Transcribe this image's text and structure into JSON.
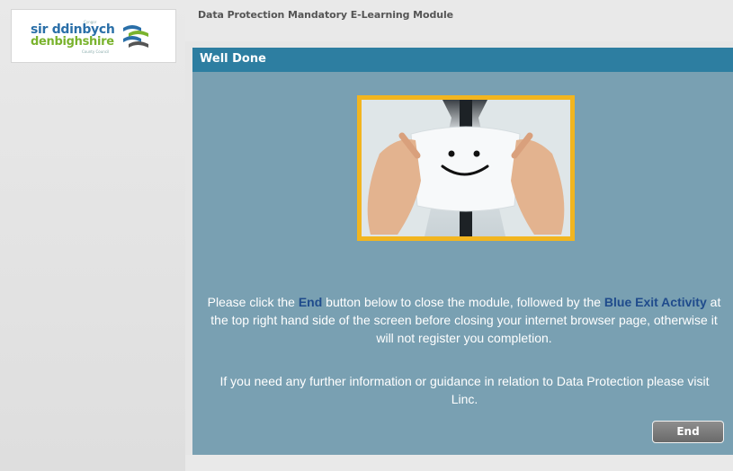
{
  "logo": {
    "small_top": "Cyngor",
    "line1": "sir ddinbych",
    "line2": "denbighshire",
    "small_bottom": "County Council"
  },
  "topbar": {
    "title": "Data Protection Mandatory E-Learning Module"
  },
  "panel": {
    "title": "Well Done",
    "image_alt": "smiley-face-card",
    "text_before_end": "Please click the ",
    "end_word": "End",
    "text_after_end": " button below to close the module, followed by the ",
    "blue_exit": "Blue Exit Activity",
    "text_after_exit": " at the top right hand side of the screen before closing your internet browser page, otherwise it will not register you completion.",
    "info": "If you need any further information or guidance in relation to Data Protection please visit Linc.",
    "end_button": "End"
  },
  "colors": {
    "panel_bg": "#79a0b2",
    "header_bg": "#2d7ea1",
    "frame": "#f2b51f",
    "highlight": "#1f4b8c"
  }
}
